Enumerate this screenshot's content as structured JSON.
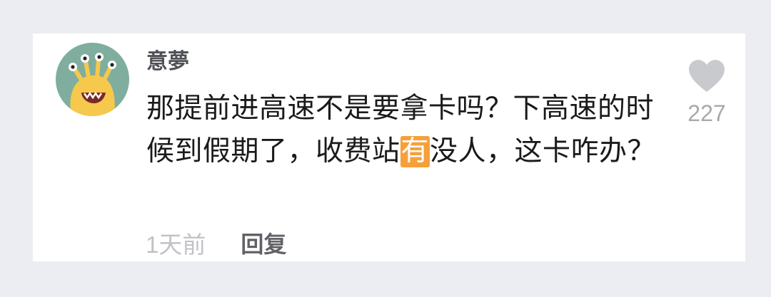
{
  "comment": {
    "username": "意夢",
    "text_before": "那提前进高速不是要拿卡吗？下高速的时候到假期了，收费站",
    "highlight": "有",
    "text_after": "没人，这卡咋办？",
    "time": "1天前",
    "reply_label": "回复",
    "likes": "227",
    "avatar_icon": "alien-monster-avatar",
    "like_icon": "heart-icon"
  },
  "colors": {
    "highlight_bg": "#f7a03b",
    "avatar_bg": "#7fae9e",
    "avatar_face": "#f6c84c"
  }
}
